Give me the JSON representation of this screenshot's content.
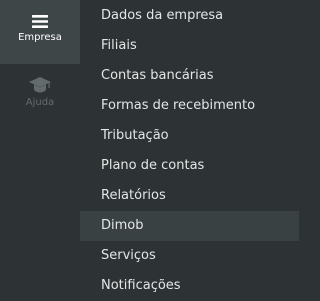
{
  "sidebar": {
    "items": [
      {
        "label": "Empresa",
        "icon": "hamburger-menu-icon",
        "active": true
      },
      {
        "label": "Ajuda",
        "icon": "graduation-cap-icon",
        "active": false
      }
    ]
  },
  "submenu": {
    "items": [
      {
        "label": "Dados da empresa"
      },
      {
        "label": "Filiais"
      },
      {
        "label": "Contas bancárias"
      },
      {
        "label": "Formas de recebimento"
      },
      {
        "label": "Tributação"
      },
      {
        "label": "Plano de contas"
      },
      {
        "label": "Relatórios"
      },
      {
        "label": "Dimob",
        "selected": true
      },
      {
        "label": "Serviços"
      },
      {
        "label": "Notificações"
      }
    ]
  },
  "colors": {
    "background": "#2d3335",
    "active_sidebar": "#3f4648",
    "selected_row": "#3a4143",
    "text": "#e4e6e6",
    "muted": "#646b6d"
  }
}
